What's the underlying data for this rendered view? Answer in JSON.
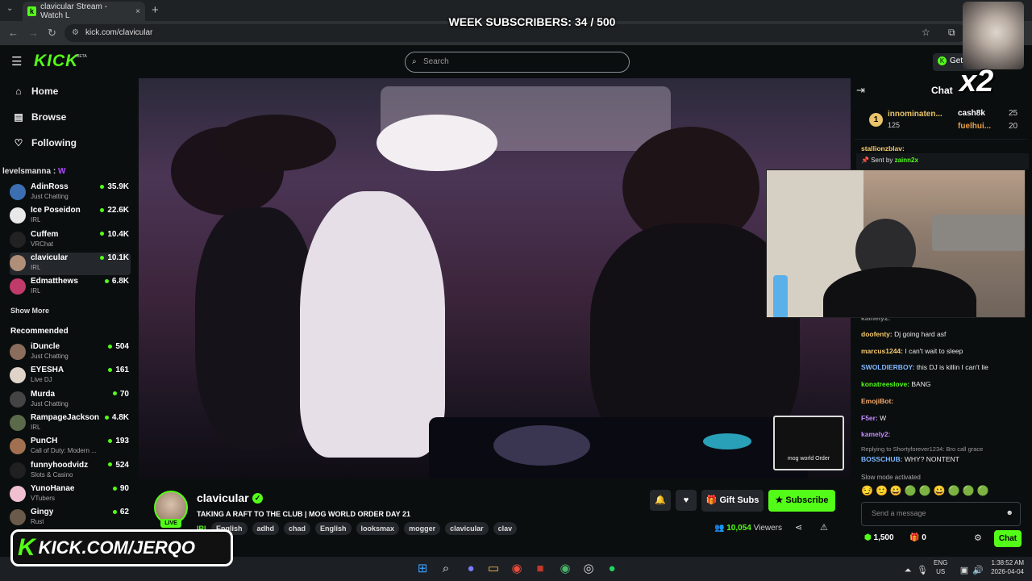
{
  "browser": {
    "tab_title": "clavicular Stream - Watch L",
    "tab_close": "×",
    "new_tab": "+",
    "url": "kick.com/clavicular",
    "back": "←",
    "forward": "→",
    "reload": "↻"
  },
  "overlay": {
    "week_subs": "WEEK SUBSCRIBERS: 34 / 500",
    "x2": "x2",
    "promo_logo": "K",
    "promo_text": "KICK.COM/JERQO"
  },
  "header": {
    "logo": "KICK",
    "beta": "BETA",
    "search_placeholder": "Search",
    "get_label": "Get"
  },
  "sidebar": {
    "nav": [
      {
        "label": "Home",
        "icon": "home-icon"
      },
      {
        "label": "Browse",
        "icon": "compass-icon"
      },
      {
        "label": "Following",
        "icon": "heart-icon"
      }
    ],
    "following_header": "levelsmanna :",
    "following": [
      {
        "name": "AdinRoss",
        "category": "Just Chatting",
        "viewers": "35.9K",
        "color": "#3c6fb2"
      },
      {
        "name": "Ice Poseidon",
        "category": "IRL",
        "viewers": "22.6K",
        "color": "#e8e8e8"
      },
      {
        "name": "Cuffem",
        "category": "VRChat",
        "viewers": "10.4K",
        "color": "#222222"
      },
      {
        "name": "clavicular",
        "category": "IRL",
        "viewers": "10.1K",
        "color": "#b08f78"
      },
      {
        "name": "Edmatthews",
        "category": "IRL",
        "viewers": "6.8K",
        "color": "#c03a6a"
      }
    ],
    "show_more": "Show More",
    "recommended_header": "Recommended",
    "recommended": [
      {
        "name": "iDuncle",
        "category": "Just Chatting",
        "viewers": "504",
        "color": "#8a6d5c"
      },
      {
        "name": "EYESHA",
        "category": "Live DJ",
        "viewers": "161",
        "color": "#e0d4c8"
      },
      {
        "name": "Murda",
        "category": "Just Chatting",
        "viewers": "70",
        "color": "#444444"
      },
      {
        "name": "RampageJackson",
        "category": "IRL",
        "viewers": "4.8K",
        "color": "#5a6a4a"
      },
      {
        "name": "PunCH",
        "category": "Call of Duty: Modern ...",
        "viewers": "193",
        "color": "#a07050"
      },
      {
        "name": "funnyhoodvidz",
        "category": "Slots & Casino",
        "viewers": "524",
        "color": "#202020"
      },
      {
        "name": "YunoHanae",
        "category": "VTubers",
        "viewers": "90",
        "color": "#f0c0d0"
      },
      {
        "name": "Gingy",
        "category": "Rust",
        "viewers": "62",
        "color": "#6a5a4a"
      }
    ]
  },
  "video": {
    "watermark_text": "mog world Order"
  },
  "stream": {
    "channel": "clavicular",
    "live": "LIVE",
    "title": "TAKING A RAFT TO THE CLUB | MOG WORLD ORDER DAY 21",
    "category": "IRL",
    "tags": [
      "English",
      "adhd",
      "chad",
      "English",
      "looksmax",
      "mogger",
      "clavicular",
      "clav"
    ],
    "viewers": "10,054",
    "viewers_label": "Viewers",
    "gift_subs": "Gift Subs",
    "subscribe": "Subscribe"
  },
  "chat": {
    "title": "Chat",
    "leaderboard": [
      {
        "rank": "1",
        "name": "innominaten...",
        "value": "125"
      },
      {
        "name": "cash8k",
        "value": "25"
      },
      {
        "name": "fuelhui...",
        "value": "20"
      }
    ],
    "partial_user": "stallionzblav:",
    "pinned_by": "Sent by",
    "pinned_user": "zainn2x",
    "partial_top": "kameiy2:",
    "messages": [
      {
        "user": "doofenty:",
        "text": "Dj going hard asf",
        "color": "#f6c96b"
      },
      {
        "user": "marcus1244:",
        "text": "I can't wait to sleep",
        "color": "#f6c96b"
      },
      {
        "user": "SWOLDIERBOY:",
        "text": "this DJ is killin I can't lie",
        "color": "#7fb7ff"
      },
      {
        "user": "konatreeslove:",
        "text": "BANG",
        "color": "#53fc18"
      },
      {
        "user": "EmojiBot:",
        "text": "",
        "color": "#f6a96b"
      },
      {
        "user": "F5er:",
        "text": "W",
        "color": "#c48bff"
      },
      {
        "user": "kamely2:",
        "text": "",
        "color": "#c48bff"
      }
    ],
    "reply_note": "Replying to Shortyforever1234: Bro call grace",
    "reply": {
      "user": "BOSSCHUB:",
      "text": "WHY? NONTENT",
      "color": "#7fb7ff"
    },
    "slow_mode": "Slow mode activated",
    "input_placeholder": "Send a message",
    "points": "1,500",
    "points2": "0",
    "chat_button": "Chat"
  },
  "taskbar": {
    "lang_top": "ENG",
    "lang_bottom": "US",
    "time": "1:38:52 AM",
    "date": "2026-04-04"
  }
}
